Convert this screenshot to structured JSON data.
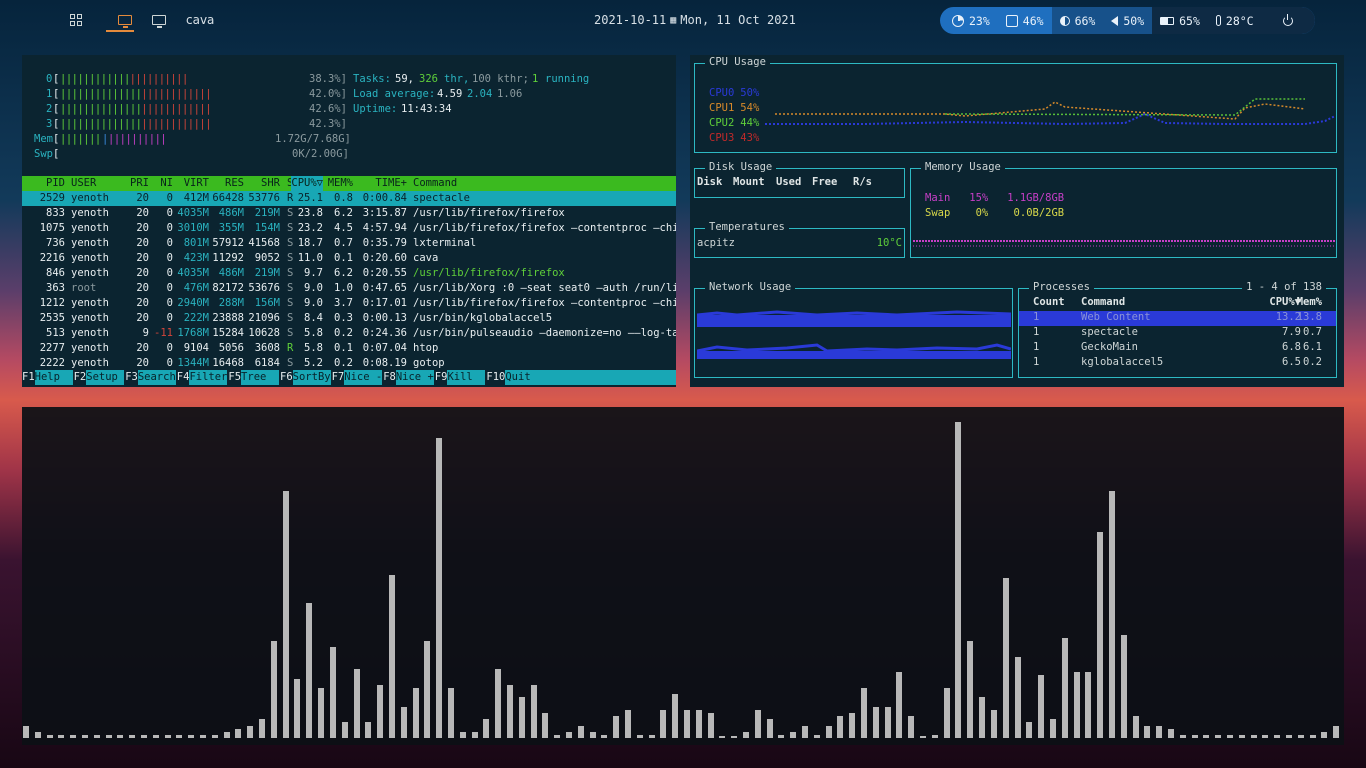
{
  "topbar": {
    "window_title": "cava",
    "date": "2021-10-11",
    "date_long": "Mon, 11 Oct 2021",
    "status": {
      "cpu": "23%",
      "mem": "46%",
      "brightness": "66%",
      "volume": "50%",
      "battery": "65%",
      "temp": "28°C"
    }
  },
  "htop": {
    "cpu_meters": [
      {
        "id": "0",
        "pct": "38.3%]"
      },
      {
        "id": "1",
        "pct": "42.0%]"
      },
      {
        "id": "2",
        "pct": "42.6%]"
      },
      {
        "id": "3",
        "pct": "42.3%]"
      }
    ],
    "mem_label": "Mem",
    "mem_value": "1.72G/7.68G]",
    "swp_label": "Swp",
    "swp_value": "0K/2.00G]",
    "tasks_label": "Tasks:",
    "tasks": "59,",
    "thr": "326",
    "thr_label": "thr,",
    "kthr": "100 kthr;",
    "running": "1",
    "running_label": "running",
    "load_label": "Load average:",
    "load1": "4.59",
    "load5": "2.04",
    "load15": "1.06",
    "uptime_label": "Uptime:",
    "uptime": "11:43:34",
    "columns": [
      "PID",
      "USER",
      "PRI",
      "NI",
      "VIRT",
      "RES",
      "SHR",
      "S",
      "CPU%▽",
      "MEM%",
      "TIME+",
      "Command"
    ],
    "processes": [
      [
        "2529",
        "yenoth",
        "20",
        "0",
        "412M",
        "66428",
        "53776",
        "R",
        "25.1",
        "0.8",
        "0:00.84",
        "spectacle"
      ],
      [
        "833",
        "yenoth",
        "20",
        "0",
        "4035M",
        "486M",
        "219M",
        "S",
        "23.8",
        "6.2",
        "3:15.87",
        "/usr/lib/firefox/firefox"
      ],
      [
        "1075",
        "yenoth",
        "20",
        "0",
        "3010M",
        "355M",
        "154M",
        "S",
        "23.2",
        "4.5",
        "4:57.94",
        "/usr/lib/firefox/firefox —contentproc —chil"
      ],
      [
        "736",
        "yenoth",
        "20",
        "0",
        "801M",
        "57912",
        "41568",
        "S",
        "18.7",
        "0.7",
        "0:35.79",
        "lxterminal"
      ],
      [
        "2216",
        "yenoth",
        "20",
        "0",
        "423M",
        "11292",
        "9052",
        "S",
        "11.0",
        "0.1",
        "0:20.60",
        "cava"
      ],
      [
        "846",
        "yenoth",
        "20",
        "0",
        "4035M",
        "486M",
        "219M",
        "S",
        "9.7",
        "6.2",
        "0:20.55",
        "/usr/lib/firefox/firefox"
      ],
      [
        "363",
        "root",
        "20",
        "0",
        "476M",
        "82172",
        "53676",
        "S",
        "9.0",
        "1.0",
        "0:47.65",
        "/usr/lib/Xorg :0 —seat seat0 —auth /run/lig"
      ],
      [
        "1212",
        "yenoth",
        "20",
        "0",
        "2940M",
        "288M",
        "156M",
        "S",
        "9.0",
        "3.7",
        "0:17.01",
        "/usr/lib/firefox/firefox —contentproc —chil"
      ],
      [
        "2535",
        "yenoth",
        "20",
        "0",
        "222M",
        "23888",
        "21096",
        "S",
        "8.4",
        "0.3",
        "0:00.13",
        "/usr/bin/kglobalaccel5"
      ],
      [
        "513",
        "yenoth",
        "9",
        "-11",
        "1768M",
        "15284",
        "10628",
        "S",
        "5.8",
        "0.2",
        "0:24.36",
        "/usr/bin/pulseaudio —daemonize=no ——log-ta"
      ],
      [
        "2277",
        "yenoth",
        "20",
        "0",
        "9104",
        "5056",
        "3608",
        "R",
        "5.8",
        "0.1",
        "0:07.04",
        "htop"
      ],
      [
        "2222",
        "yenoth",
        "20",
        "0",
        "1344M",
        "16468",
        "6184",
        "S",
        "5.2",
        "0.2",
        "0:08.19",
        "gotop"
      ]
    ],
    "fkeys": [
      {
        "k": "F1",
        "l": "Help  "
      },
      {
        "k": "F2",
        "l": "Setup "
      },
      {
        "k": "F3",
        "l": "Search"
      },
      {
        "k": "F4",
        "l": "Filter"
      },
      {
        "k": "F5",
        "l": "Tree  "
      },
      {
        "k": "F6",
        "l": "SortBy"
      },
      {
        "k": "F7",
        "l": "Nice -"
      },
      {
        "k": "F8",
        "l": "Nice +"
      },
      {
        "k": "F9",
        "l": "Kill  "
      },
      {
        "k": "F10",
        "l": "Quit"
      }
    ]
  },
  "gotop": {
    "cpu_title": "CPU Usage",
    "cpu_legend": [
      {
        "name": "CPU0",
        "pct": "50%",
        "color": "#2a3ad8"
      },
      {
        "name": "CPU1",
        "pct": "54%",
        "color": "#d6892a"
      },
      {
        "name": "CPU2",
        "pct": "44%",
        "color": "#5fcf3a"
      },
      {
        "name": "CPU3",
        "pct": "43%",
        "color": "#c02a2a"
      }
    ],
    "disk_title": "Disk Usage",
    "disk_columns": [
      "Disk",
      "Mount",
      "Used",
      "Free",
      "R/s"
    ],
    "temp_title": "Temperatures",
    "temp_sensor": "acpitz",
    "temp_value": "10°C",
    "mem_title": "Memory Usage",
    "mem_main": {
      "label": "Main",
      "pct": "15%",
      "val": "1.1GB/8GB"
    },
    "mem_swap": {
      "label": "Swap",
      "pct": "0%",
      "val": "0.0B/2GB"
    },
    "net_title": "Network Usage",
    "proc_title": "Processes",
    "proc_count": "1 - 4 of 138",
    "proc_columns": [
      "Count",
      "Command",
      "CPU%▼",
      "Mem%"
    ],
    "processes": [
      [
        "1",
        "Web Content",
        "13.2",
        "13.8"
      ],
      [
        "1",
        "spectacle",
        "7.9",
        "0.7"
      ],
      [
        "1",
        "GeckoMain",
        "6.8",
        "6.1"
      ],
      [
        "1",
        "kglobalaccel5",
        "6.5",
        "0.2"
      ]
    ]
  },
  "cava": {
    "levels": [
      4,
      2,
      1,
      1,
      1,
      1,
      1,
      1,
      1,
      1,
      1,
      1,
      1,
      1,
      1,
      1,
      1,
      2,
      3,
      4,
      6,
      31,
      79,
      19,
      43,
      16,
      29,
      5,
      22,
      5,
      17,
      52,
      10,
      16,
      31,
      96,
      16,
      2,
      2,
      6,
      22,
      17,
      13,
      17,
      8,
      1,
      2,
      4,
      2,
      1,
      7,
      9,
      1,
      1,
      9,
      14,
      9,
      9,
      8,
      0,
      0,
      2,
      9,
      6,
      1,
      2,
      4,
      1,
      4,
      7,
      8,
      16,
      10,
      10,
      21,
      7,
      0,
      1,
      16,
      101,
      31,
      13,
      9,
      51,
      26,
      5,
      20,
      6,
      32,
      21,
      21,
      66,
      79,
      33,
      7,
      4,
      4,
      3,
      1,
      1,
      1,
      1,
      1,
      1,
      1,
      1,
      1,
      1,
      1,
      1,
      2,
      4
    ]
  }
}
